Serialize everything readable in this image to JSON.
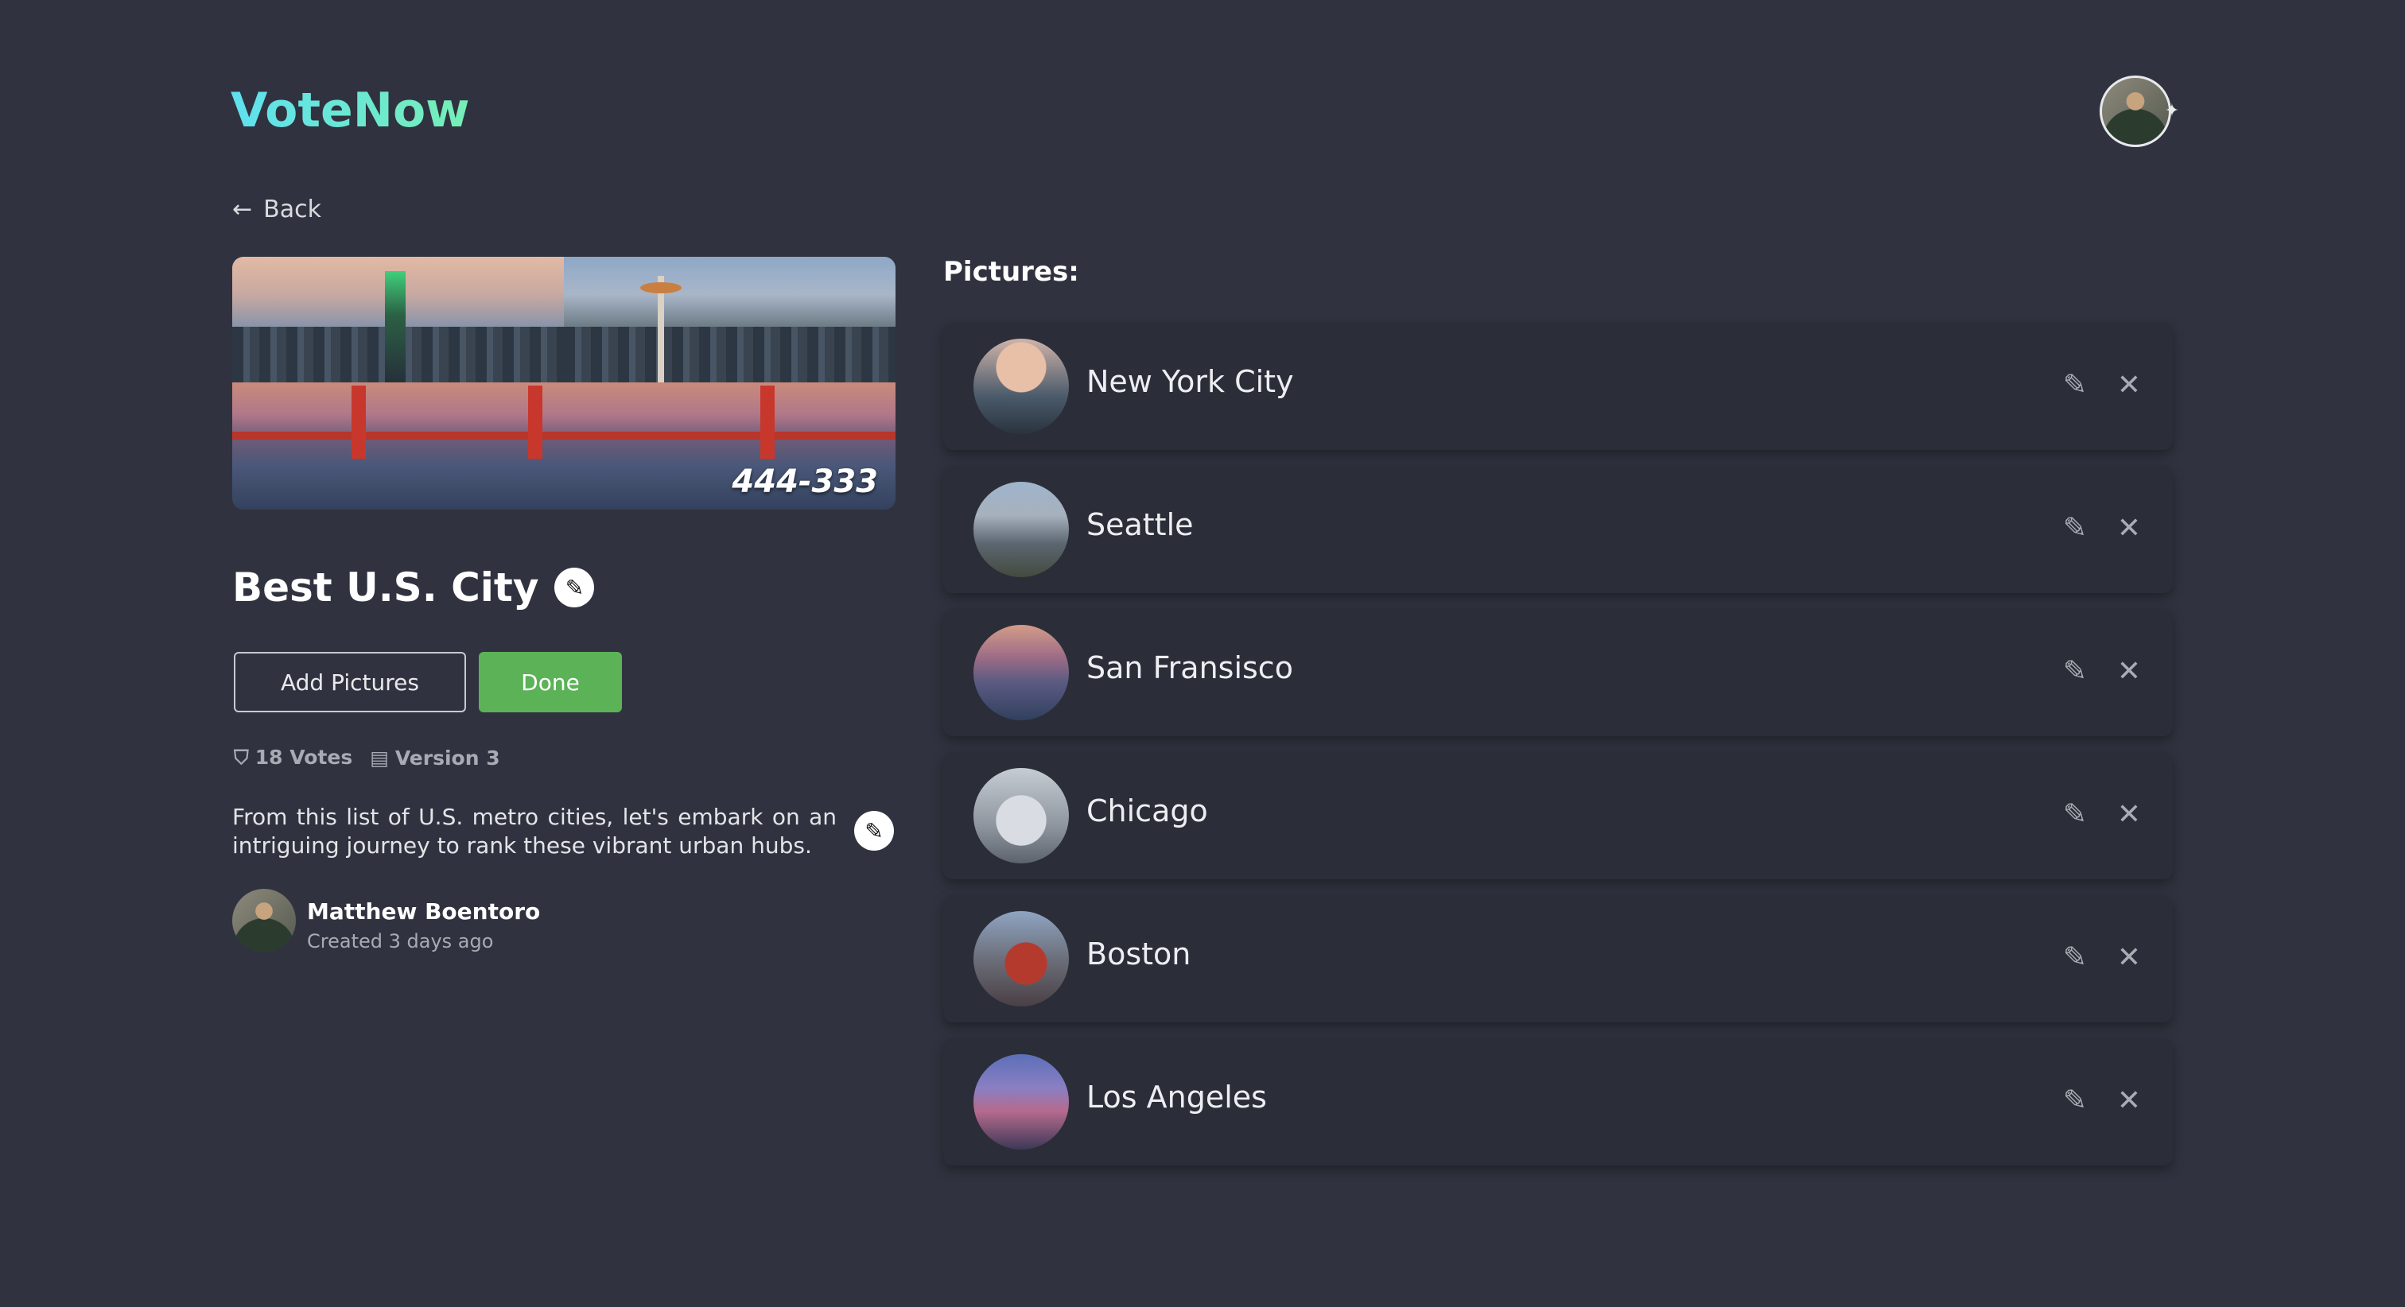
{
  "app": {
    "logo": "VoteNow"
  },
  "nav": {
    "back_label": "Back",
    "back_icon": "arrow-left-icon"
  },
  "poll": {
    "banner_code": "444-333",
    "title": "Best U.S. City",
    "add_pictures_label": "Add Pictures",
    "done_label": "Done",
    "votes": "18 Votes",
    "version": "Version 3",
    "description": "From this list of U.S. metro cities, let's embark on an intriguing journey to rank these vibrant urban hubs.",
    "author": {
      "name": "Matthew Boentoro",
      "created": "Created 3 days ago"
    }
  },
  "pictures": {
    "label": "Pictures:",
    "items": [
      {
        "name": "New York City"
      },
      {
        "name": "Seattle"
      },
      {
        "name": "San Fransisco"
      },
      {
        "name": "Chicago"
      },
      {
        "name": "Boston"
      },
      {
        "name": "Los Angeles"
      }
    ]
  },
  "colors": {
    "background": "#30333f",
    "card": "#2b2e39",
    "accent_green": "#5cb257",
    "logo_gradient": [
      "#5fe0f0",
      "#77efb6"
    ]
  }
}
